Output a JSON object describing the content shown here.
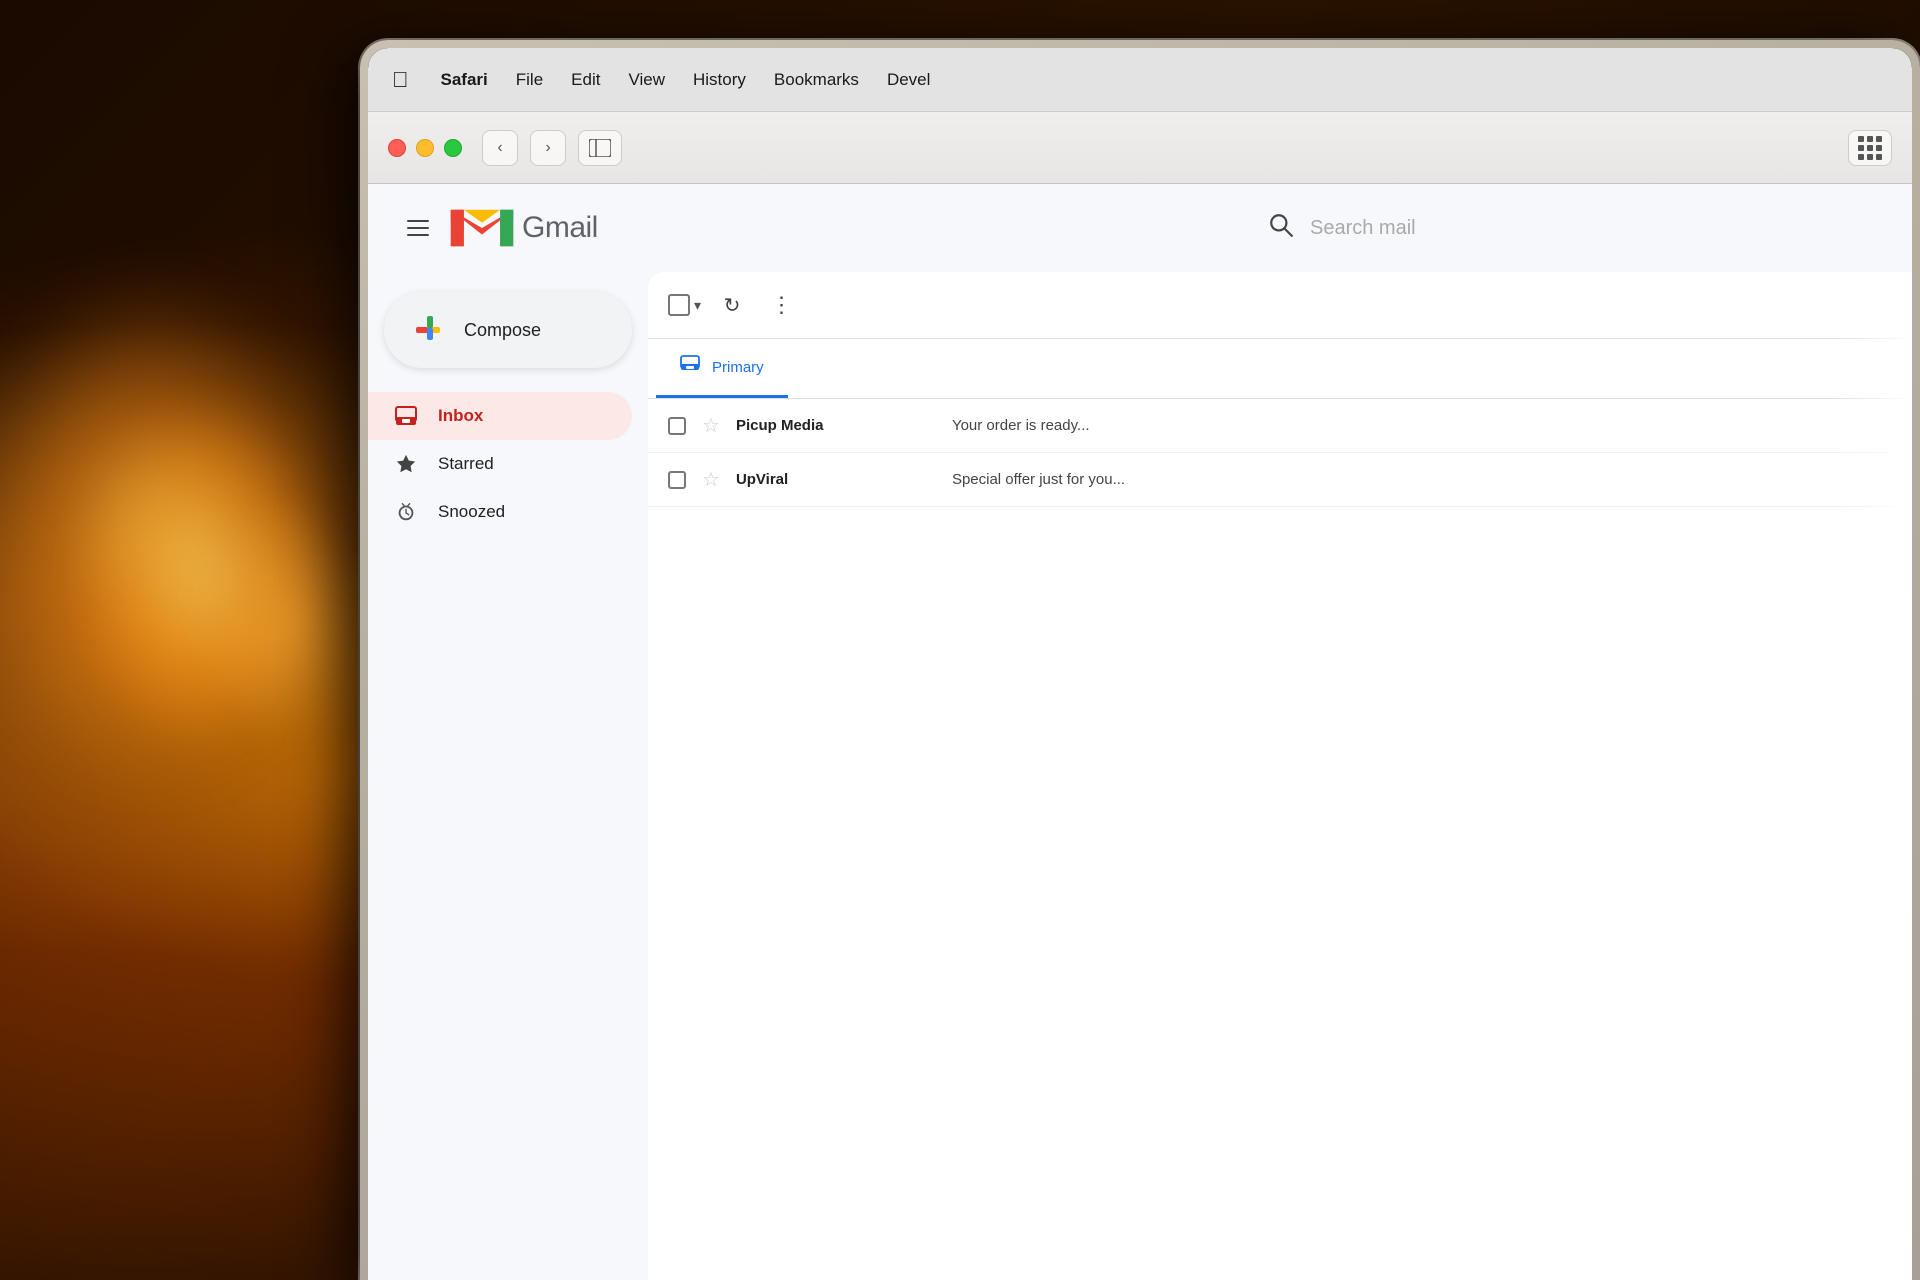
{
  "background": {
    "color": "#1a0a00"
  },
  "menubar": {
    "apple_symbol": "🍎",
    "items": [
      "Safari",
      "File",
      "Edit",
      "View",
      "History",
      "Bookmarks",
      "Devel"
    ]
  },
  "safari_toolbar": {
    "back_label": "‹",
    "forward_label": "›",
    "sidebar_icon": "▣",
    "grid_icon": "grid"
  },
  "gmail": {
    "header": {
      "hamburger_label": "menu",
      "logo_text": "Gmail",
      "search_placeholder": "Search mail"
    },
    "sidebar": {
      "compose_label": "Compose",
      "nav_items": [
        {
          "id": "inbox",
          "label": "Inbox",
          "icon": "inbox",
          "active": true
        },
        {
          "id": "starred",
          "label": "Starred",
          "icon": "star",
          "active": false
        },
        {
          "id": "snoozed",
          "label": "Snoozed",
          "icon": "clock",
          "active": false
        }
      ]
    },
    "toolbar": {
      "select_all_label": "select all",
      "refresh_label": "↻",
      "more_label": "⋮"
    },
    "tabs": [
      {
        "id": "primary",
        "label": "Primary",
        "active": true
      }
    ],
    "emails": [
      {
        "sender": "Picup Media",
        "preview": "Your order is ready...",
        "starred": false
      },
      {
        "sender": "UpViral",
        "preview": "Special offer just for you...",
        "starred": false
      }
    ]
  }
}
